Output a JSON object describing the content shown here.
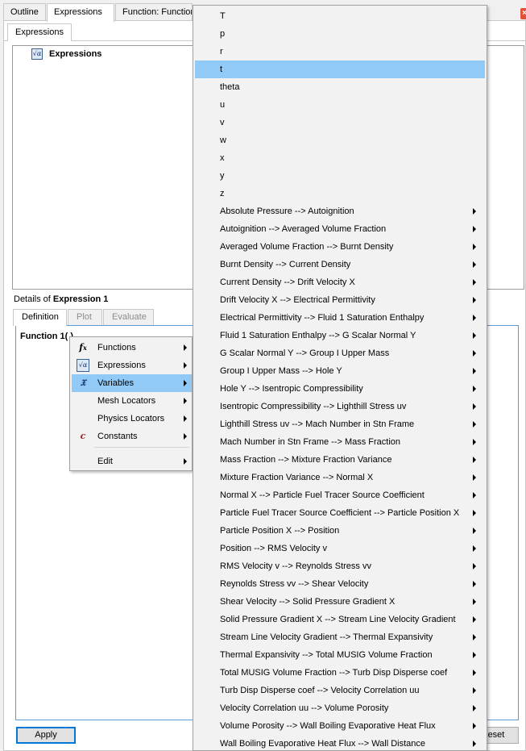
{
  "top_tabs": [
    "Outline",
    "Expressions",
    "Function: Function 1"
  ],
  "sub_tab": "Expressions",
  "tree": {
    "root_label": "Expressions"
  },
  "details": {
    "prefix": "Details of ",
    "name": "Expression 1"
  },
  "detail_tabs": [
    "Definition",
    "Plot",
    "Evaluate"
  ],
  "editor_text": "Function 1( )",
  "buttons": {
    "apply": "Apply",
    "reset": "Reset"
  },
  "context_menu": {
    "items": [
      {
        "label": "Functions",
        "icon": "function-fx-icon",
        "glyph": "fx"
      },
      {
        "label": "Expressions",
        "icon": "expression-icon",
        "glyph": "√α"
      },
      {
        "label": "Variables",
        "icon": "variable-x-icon",
        "glyph": "𝔛"
      },
      {
        "label": "Mesh Locators",
        "icon": "",
        "glyph": ""
      },
      {
        "label": "Physics Locators",
        "icon": "",
        "glyph": ""
      },
      {
        "label": "Constants",
        "icon": "constant-c-icon",
        "glyph": "c"
      },
      {
        "label": "Edit",
        "icon": "",
        "glyph": ""
      }
    ],
    "highlighted": "Variables"
  },
  "variables_menu": {
    "highlighted": "t",
    "items": [
      {
        "label": "T",
        "submenu": false
      },
      {
        "label": "p",
        "submenu": false
      },
      {
        "label": "r",
        "submenu": false
      },
      {
        "label": "t",
        "submenu": false
      },
      {
        "label": "theta",
        "submenu": false
      },
      {
        "label": "u",
        "submenu": false
      },
      {
        "label": "v",
        "submenu": false
      },
      {
        "label": "w",
        "submenu": false
      },
      {
        "label": "x",
        "submenu": false
      },
      {
        "label": "y",
        "submenu": false
      },
      {
        "label": "z",
        "submenu": false
      },
      {
        "label": "Absolute Pressure  -->  Autoignition",
        "submenu": true
      },
      {
        "label": "Autoignition  -->  Averaged Volume Fraction",
        "submenu": true
      },
      {
        "label": "Averaged Volume Fraction  -->  Burnt Density",
        "submenu": true
      },
      {
        "label": "Burnt Density  -->  Current Density",
        "submenu": true
      },
      {
        "label": "Current Density  -->  Drift Velocity X",
        "submenu": true
      },
      {
        "label": "Drift Velocity X  -->  Electrical Permittivity",
        "submenu": true
      },
      {
        "label": "Electrical Permittivity  -->  Fluid 1 Saturation Enthalpy",
        "submenu": true
      },
      {
        "label": "Fluid 1 Saturation Enthalpy  -->  G Scalar Normal Y",
        "submenu": true
      },
      {
        "label": "G Scalar Normal Y  -->  Group I Upper Mass",
        "submenu": true
      },
      {
        "label": "Group I Upper Mass  -->  Hole Y",
        "submenu": true
      },
      {
        "label": "Hole Y  -->  Isentropic Compressibility",
        "submenu": true
      },
      {
        "label": "Isentropic Compressibility  -->  Lighthill Stress uv",
        "submenu": true
      },
      {
        "label": "Lighthill Stress uv  -->  Mach Number in Stn Frame",
        "submenu": true
      },
      {
        "label": "Mach Number in Stn Frame  -->  Mass Fraction",
        "submenu": true
      },
      {
        "label": "Mass Fraction  -->  Mixture Fraction Variance",
        "submenu": true
      },
      {
        "label": "Mixture Fraction Variance  -->  Normal X",
        "submenu": true
      },
      {
        "label": "Normal X  -->  Particle Fuel Tracer Source Coefficient",
        "submenu": true
      },
      {
        "label": "Particle Fuel Tracer Source Coefficient  -->  Particle Position X",
        "submenu": true
      },
      {
        "label": "Particle Position X  -->  Position",
        "submenu": true
      },
      {
        "label": "Position  -->  RMS Velocity v",
        "submenu": true
      },
      {
        "label": "RMS Velocity v  -->  Reynolds Stress vv",
        "submenu": true
      },
      {
        "label": "Reynolds Stress vv  -->  Shear Velocity",
        "submenu": true
      },
      {
        "label": "Shear Velocity  -->  Solid Pressure Gradient X",
        "submenu": true
      },
      {
        "label": "Solid Pressure Gradient X  -->  Stream Line Velocity Gradient",
        "submenu": true
      },
      {
        "label": "Stream Line Velocity Gradient  -->  Thermal Expansivity",
        "submenu": true
      },
      {
        "label": "Thermal Expansivity  -->  Total MUSIG Volume Fraction",
        "submenu": true
      },
      {
        "label": "Total MUSIG Volume Fraction  -->  Turb Disp Disperse coef",
        "submenu": true
      },
      {
        "label": "Turb Disp Disperse coef  -->  Velocity Correlation uu",
        "submenu": true
      },
      {
        "label": "Velocity Correlation uu  -->  Volume Porosity",
        "submenu": true
      },
      {
        "label": "Volume Porosity  -->  Wall Boiling Evaporative Heat Flux",
        "submenu": true
      },
      {
        "label": "Wall Boiling Evaporative Heat Flux  -->  Wall Distance",
        "submenu": true
      }
    ]
  },
  "colors": {
    "highlight": "#91c9f7",
    "focus_border": "#0078d7",
    "close": "#e0533a"
  }
}
